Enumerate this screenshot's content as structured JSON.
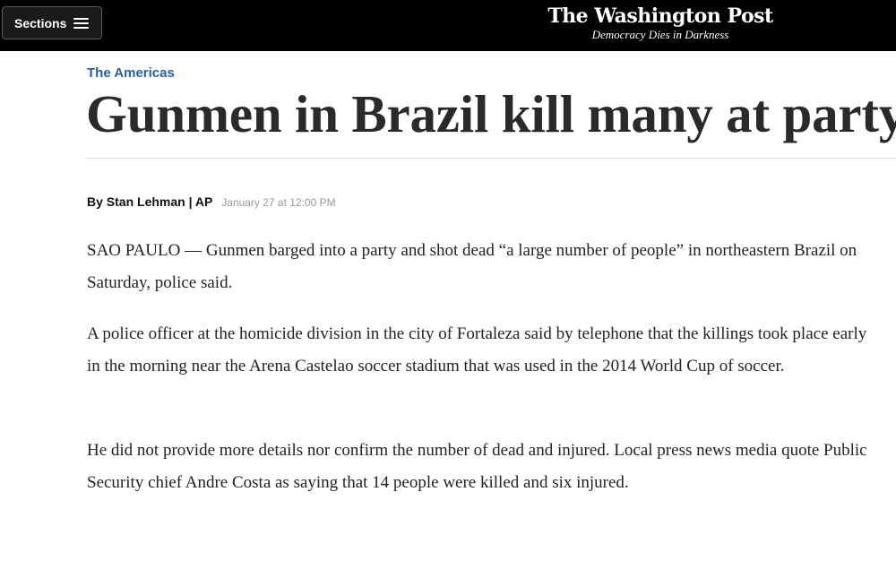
{
  "header": {
    "sections_label": "Sections",
    "logo": "The Washington Post",
    "tagline": "Democracy Dies in Darkness"
  },
  "article": {
    "kicker": "The Americas",
    "headline": "Gunmen in Brazil kill many at party",
    "byline_author": "By Stan Lehman | AP",
    "byline_date": "January 27 at 12:00 PM",
    "paragraphs": [
      "SAO PAULO — Gunmen barged into a party and shot dead “a large number of people” in northeastern Brazil on Saturday, police said.",
      "A police officer at the homicide division in the city of Fortaleza said by telephone that the killings took place early in the morning near the Arena Castelao soccer stadium that was used in the 2014 World Cup of soccer.",
      "He did not provide more details nor confirm the number of dead and injured. Local press news media quote Public Security chief Andre Costa as saying that 14 people were killed and six injured."
    ]
  },
  "colors": {
    "topbar": "#000000",
    "kicker": "#2a5d9c",
    "headline": "#2a2a2a",
    "date": "#9a9a9a"
  }
}
